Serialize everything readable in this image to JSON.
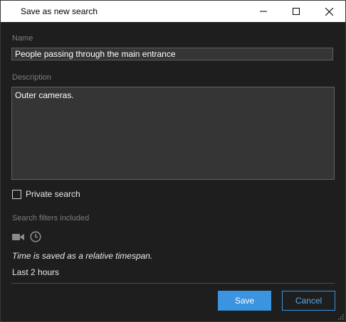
{
  "window": {
    "title": "Save as new search",
    "controls": [
      "minimize-icon",
      "maximize-icon",
      "close-icon"
    ]
  },
  "form": {
    "name_label": "Name",
    "name_value": "People passing through the main entrance",
    "description_label": "Description",
    "description_value": "Outer cameras.",
    "private_label": "Private search",
    "private_checked": false
  },
  "filters": {
    "heading": "Search filters included",
    "icons": [
      "camera-icon",
      "clock-icon"
    ],
    "note": "Time is saved as a relative timespan.",
    "timespan": "Last 2 hours"
  },
  "buttons": {
    "save": "Save",
    "cancel": "Cancel"
  },
  "colors": {
    "background": "#1e1e1e",
    "input_bg": "#353535",
    "accent": "#3a94df",
    "muted_text": "#7d7d7d"
  }
}
